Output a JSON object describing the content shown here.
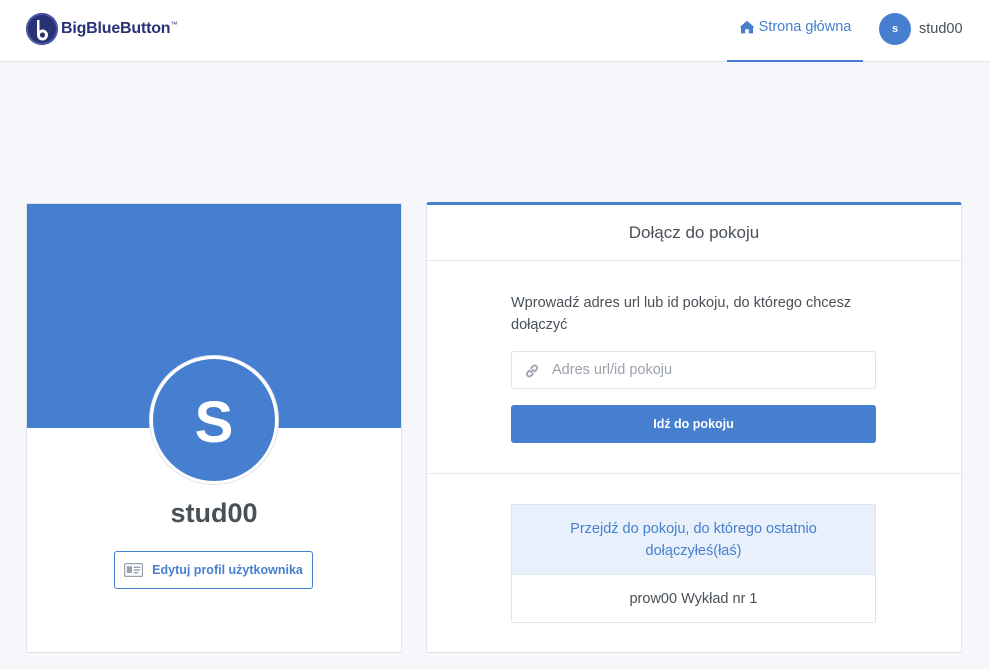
{
  "header": {
    "logo_text": "BigBlueButton",
    "logo_tm": "™",
    "nav_home_label": "Strona główna",
    "user_initial": "s",
    "user_name": "stud00"
  },
  "profile": {
    "avatar_letter": "S",
    "name": "stud00",
    "edit_button_label": "Edytuj profil użytkownika"
  },
  "join_room": {
    "title": "Dołącz do pokoju",
    "instruction": "Wprowadź adres url lub id pokoju, do którego chcesz dołączyć",
    "input_placeholder": "Adres url/id pokoju",
    "input_value": "",
    "go_button_label": "Idź do pokoju",
    "recent_heading": "Przejdź do pokoju, do którego ostatnio dołączyłeś(łaś)",
    "recent_rooms": [
      "prow00 Wykład nr 1"
    ]
  },
  "colors": {
    "accent": "#467fcf",
    "brand_dark": "#283274",
    "background": "#f5f7fb"
  },
  "icons": {
    "logo": "bigbluebutton-logo-icon",
    "home": "home-icon",
    "link": "link-icon",
    "id_card": "id-card-icon"
  }
}
